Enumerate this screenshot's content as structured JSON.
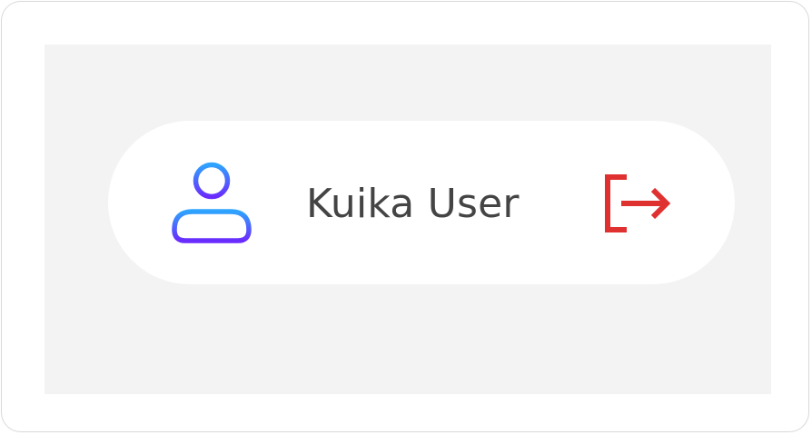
{
  "user": {
    "name": "Kuika User",
    "icon": "user-icon",
    "icon_gradient": [
      "#2ea3ff",
      "#6a2bff"
    ]
  },
  "logout": {
    "icon": "logout-icon",
    "color": "#e03131"
  },
  "colors": {
    "frame_border": "#d9d9d9",
    "canvas_background": "#f3f3f3",
    "pill_background": "#ffffff",
    "name_text": "#444444"
  }
}
